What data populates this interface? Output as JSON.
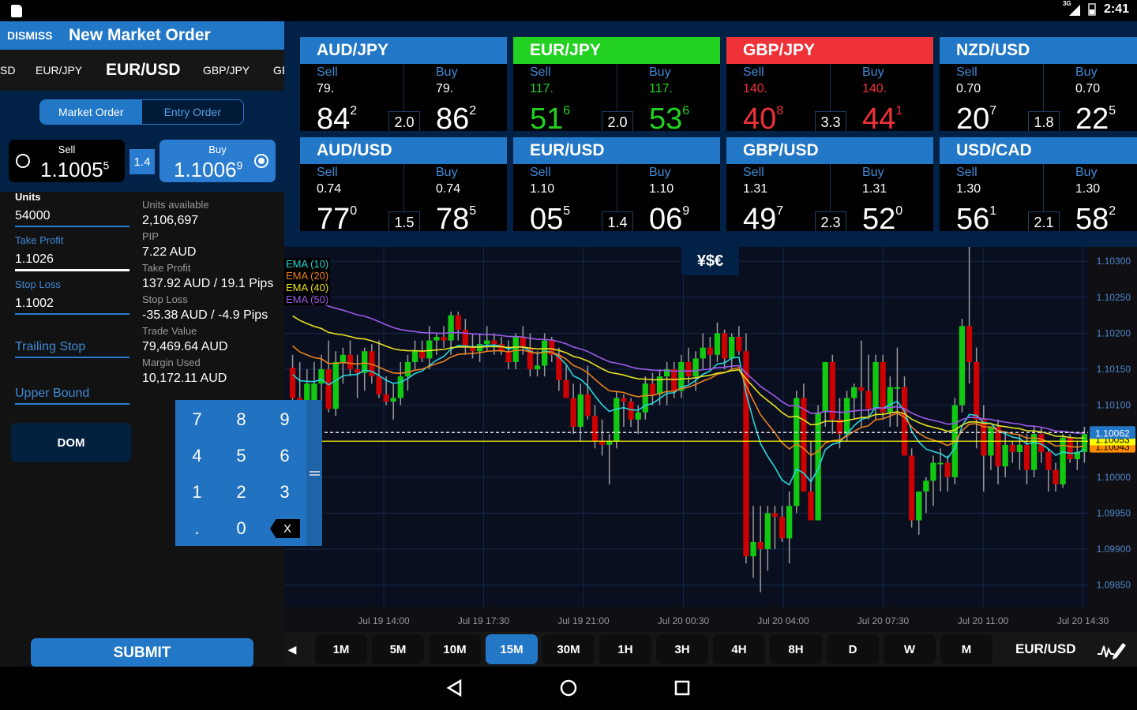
{
  "status_bar": {
    "network": "3G",
    "time": "2:41"
  },
  "order_panel": {
    "dismiss_label": "DISMISS",
    "title": "New Market Order",
    "pair_tabs": [
      "SD",
      "EUR/JPY",
      "EUR/USD",
      "GBP/JPY",
      "GE"
    ],
    "active_pair": "EUR/USD",
    "order_types": [
      {
        "label": "Market Order",
        "selected": true
      },
      {
        "label": "Entry Order",
        "selected": false
      }
    ],
    "sell": {
      "label": "Sell",
      "price_main": "1.1005",
      "price_sup": "5",
      "selected": false
    },
    "buy": {
      "label": "Buy",
      "price_main": "1.1006",
      "price_sup": "9",
      "selected": true
    },
    "spread": "1.4",
    "fields": {
      "units_label": "Units",
      "units_value": "54000",
      "take_profit_label": "Take Profit",
      "take_profit_value": "1.1026",
      "stop_loss_label": "Stop Loss",
      "stop_loss_value": "1.1002",
      "trailing_stop_label": "Trailing Stop",
      "upper_bound_label": "Upper Bound"
    },
    "info": [
      {
        "label": "Units available",
        "value": "2,106,697"
      },
      {
        "label": "PIP",
        "value": "7.22 AUD"
      },
      {
        "label": "Take Profit",
        "value": "137.92 AUD / 19.1 Pips"
      },
      {
        "label": "Stop Loss",
        "value": "-35.38 AUD / -4.9 Pips"
      },
      {
        "label": "Trade Value",
        "value": "79,469.64 AUD"
      },
      {
        "label": "Margin Used",
        "value": "10,172.11 AUD"
      }
    ],
    "dom_label": "DOM",
    "submit_label": "SUBMIT"
  },
  "keypad": {
    "keys": [
      "7",
      "8",
      "9",
      "4",
      "5",
      "6",
      "1",
      "2",
      "3",
      ".",
      "0"
    ],
    "delete_label": "X"
  },
  "quotes": [
    {
      "pair": "AUD/JPY",
      "header_color": "#2277c7",
      "price_color": "#ffffff",
      "sell_label": "Sell",
      "buy_label": "Buy",
      "sell_big": "79.",
      "sell_pips": "84",
      "sell_sup": "2",
      "buy_big": "79.",
      "buy_pips": "86",
      "buy_sup": "2",
      "spread": "2.0"
    },
    {
      "pair": "EUR/JPY",
      "header_color": "#22d122",
      "price_color": "#22d122",
      "sell_label": "Sell",
      "buy_label": "Buy",
      "sell_big": "117.",
      "sell_pips": "51",
      "sell_sup": "6",
      "buy_big": "117.",
      "buy_pips": "53",
      "buy_sup": "6",
      "spread": "2.0"
    },
    {
      "pair": "GBP/JPY",
      "header_color": "#ef3138",
      "price_color": "#ef3138",
      "sell_label": "Sell",
      "buy_label": "Buy",
      "sell_big": "140.",
      "sell_pips": "40",
      "sell_sup": "8",
      "buy_big": "140.",
      "buy_pips": "44",
      "buy_sup": "1",
      "spread": "3.3"
    },
    {
      "pair": "NZD/USD",
      "header_color": "#2277c7",
      "price_color": "#ffffff",
      "sell_label": "Sell",
      "buy_label": "Buy",
      "sell_big": "0.70",
      "sell_pips": "20",
      "sell_sup": "7",
      "buy_big": "0.70",
      "buy_pips": "22",
      "buy_sup": "5",
      "spread": "1.8"
    },
    {
      "pair": "AUD/USD",
      "header_color": "#2277c7",
      "price_color": "#ffffff",
      "sell_label": "Sell",
      "buy_label": "Buy",
      "sell_big": "0.74",
      "sell_pips": "77",
      "sell_sup": "0",
      "buy_big": "0.74",
      "buy_pips": "78",
      "buy_sup": "5",
      "spread": "1.5"
    },
    {
      "pair": "EUR/USD",
      "header_color": "#2277c7",
      "price_color": "#ffffff",
      "sell_label": "Sell",
      "buy_label": "Buy",
      "sell_big": "1.10",
      "sell_pips": "05",
      "sell_sup": "5",
      "buy_big": "1.10",
      "buy_pips": "06",
      "buy_sup": "9",
      "spread": "1.4"
    },
    {
      "pair": "GBP/USD",
      "header_color": "#2277c7",
      "price_color": "#ffffff",
      "sell_label": "Sell",
      "buy_label": "Buy",
      "sell_big": "1.31",
      "sell_pips": "49",
      "sell_sup": "7",
      "buy_big": "1.31",
      "buy_pips": "52",
      "buy_sup": "0",
      "spread": "2.3"
    },
    {
      "pair": "USD/CAD",
      "header_color": "#2277c7",
      "price_color": "#ffffff",
      "sell_label": "Sell",
      "buy_label": "Buy",
      "sell_big": "1.30",
      "sell_pips": "56",
      "sell_sup": "1",
      "buy_big": "1.30",
      "buy_pips": "58",
      "buy_sup": "2",
      "spread": "2.1"
    }
  ],
  "chart": {
    "symbol_icon": "¥$€",
    "legend": [
      {
        "label": "EMA (10)",
        "color": "#27d6dc"
      },
      {
        "label": "EMA (20)",
        "color": "#e8821e"
      },
      {
        "label": "EMA (40)",
        "color": "#e8e020"
      },
      {
        "label": "EMA (50)",
        "color": "#9a5ae6"
      }
    ],
    "colors": {
      "up": "#12c912",
      "down": "#cc0000",
      "wick": "#9a9a9a",
      "grid": "#10284a",
      "axis_text": "#4d86c4"
    }
  },
  "chart_data": {
    "type": "candlestick",
    "title": "EUR/USD 15M",
    "y_ticks": [
      "1.10300",
      "1.10250",
      "1.10200",
      "1.10150",
      "1.10100",
      "1.10000",
      "1.09950",
      "1.09900",
      "1.09850"
    ],
    "ylim": [
      1.0982,
      1.1032
    ],
    "x_ticks": [
      "Jul 19 14:00",
      "Jul 19 17:30",
      "Jul 19 21:00",
      "Jul 20 00:30",
      "Jul 20 04:00",
      "Jul 20 07:30",
      "Jul 20 11:00",
      "Jul 20 14:30"
    ],
    "price_tags": [
      {
        "label": "1.10062",
        "value": 1.10062,
        "color": "#2277c7"
      },
      {
        "label": "1.10053",
        "value": 1.10053,
        "color": "#ffff00"
      },
      {
        "label": "1.10043",
        "value": 1.10043,
        "color": "#ff8c00"
      }
    ],
    "current_price_line": 1.10062,
    "horizontal_line": 1.1005,
    "candles": [
      [
        1.10152,
        1.1017,
        1.101,
        1.1011
      ],
      [
        1.1011,
        1.1016,
        1.1008,
        1.10095
      ],
      [
        1.10095,
        1.1015,
        1.1006,
        1.1013
      ],
      [
        1.1009,
        1.1016,
        1.1007,
        1.1013
      ],
      [
        1.1013,
        1.1017,
        1.1009,
        1.1015
      ],
      [
        1.1015,
        1.1019,
        1.1009,
        1.10095
      ],
      [
        1.10095,
        1.10175,
        1.10085,
        1.1016
      ],
      [
        1.1016,
        1.1018,
        1.1013,
        1.1017
      ],
      [
        1.1017,
        1.1019,
        1.1014,
        1.1015
      ],
      [
        1.1015,
        1.1017,
        1.1011,
        1.10145
      ],
      [
        1.10145,
        1.1018,
        1.1012,
        1.10175
      ],
      [
        1.10175,
        1.10185,
        1.1013,
        1.1014
      ],
      [
        1.1014,
        1.1019,
        1.1011,
        1.10115
      ],
      [
        1.10115,
        1.1014,
        1.101,
        1.10105
      ],
      [
        1.10105,
        1.1013,
        1.1008,
        1.1011
      ],
      [
        1.1011,
        1.1016,
        1.101,
        1.1014
      ],
      [
        1.1014,
        1.1017,
        1.1012,
        1.1016
      ],
      [
        1.1016,
        1.1019,
        1.1015,
        1.10175
      ],
      [
        1.10175,
        1.1019,
        1.1016,
        1.10165
      ],
      [
        1.10165,
        1.1021,
        1.1015,
        1.1019
      ],
      [
        1.1019,
        1.102,
        1.1017,
        1.10195
      ],
      [
        1.10195,
        1.1021,
        1.1018,
        1.1019
      ],
      [
        1.1019,
        1.1023,
        1.1017,
        1.10225
      ],
      [
        1.10225,
        1.1023,
        1.1019,
        1.10205
      ],
      [
        1.10205,
        1.1022,
        1.1017,
        1.1018
      ],
      [
        1.1018,
        1.102,
        1.10165,
        1.10175
      ],
      [
        1.10175,
        1.102,
        1.1016,
        1.10185
      ],
      [
        1.10185,
        1.1021,
        1.10175,
        1.1019
      ],
      [
        1.1019,
        1.102,
        1.1017,
        1.10185
      ],
      [
        1.10185,
        1.10195,
        1.1017,
        1.10175
      ],
      [
        1.10175,
        1.1019,
        1.1015,
        1.1016
      ],
      [
        1.1016,
        1.102,
        1.1015,
        1.10195
      ],
      [
        1.10195,
        1.1021,
        1.1017,
        1.1018
      ],
      [
        1.1018,
        1.102,
        1.1014,
        1.1015
      ],
      [
        1.1015,
        1.10175,
        1.1014,
        1.10155
      ],
      [
        1.10155,
        1.102,
        1.1014,
        1.1019
      ],
      [
        1.1019,
        1.10195,
        1.1016,
        1.1017
      ],
      [
        1.1017,
        1.1018,
        1.1012,
        1.10135
      ],
      [
        1.10135,
        1.10155,
        1.1011,
        1.1011
      ],
      [
        1.1011,
        1.1013,
        1.1006,
        1.1007
      ],
      [
        1.1007,
        1.1013,
        1.1005,
        1.10115
      ],
      [
        1.10115,
        1.10155,
        1.1008,
        1.10085
      ],
      [
        1.10085,
        1.101,
        1.1004,
        1.1005
      ],
      [
        1.1005,
        1.1008,
        1.1003,
        1.10045
      ],
      [
        1.10045,
        1.1006,
        1.0999,
        1.1005
      ],
      [
        1.1005,
        1.1012,
        1.1004,
        1.1011
      ],
      [
        1.1011,
        1.10115,
        1.1007,
        1.10105
      ],
      [
        1.10105,
        1.1011,
        1.1007,
        1.1008
      ],
      [
        1.1008,
        1.101,
        1.1006,
        1.1009
      ],
      [
        1.1009,
        1.1014,
        1.1008,
        1.1013
      ],
      [
        1.1013,
        1.10145,
        1.101,
        1.10115
      ],
      [
        1.10115,
        1.1015,
        1.101,
        1.1014
      ],
      [
        1.1014,
        1.1016,
        1.101,
        1.1015
      ],
      [
        1.1015,
        1.1016,
        1.1011,
        1.1012
      ],
      [
        1.1012,
        1.1017,
        1.1011,
        1.1016
      ],
      [
        1.1016,
        1.1018,
        1.1013,
        1.1014
      ],
      [
        1.1014,
        1.10175,
        1.1012,
        1.10165
      ],
      [
        1.10165,
        1.102,
        1.1015,
        1.1018
      ],
      [
        1.1018,
        1.10195,
        1.1015,
        1.1017
      ],
      [
        1.1017,
        1.10215,
        1.1016,
        1.102
      ],
      [
        1.102,
        1.10205,
        1.1015,
        1.10165
      ],
      [
        1.10165,
        1.102,
        1.1015,
        1.10195
      ],
      [
        1.10195,
        1.1021,
        1.1017,
        1.10175
      ],
      [
        1.10175,
        1.102,
        1.0988,
        1.0989
      ],
      [
        1.0989,
        1.0996,
        1.0986,
        1.0991
      ],
      [
        1.0991,
        1.0996,
        1.0984,
        1.099
      ],
      [
        1.099,
        1.0996,
        1.0987,
        1.0995
      ],
      [
        1.0995,
        1.0996,
        1.099,
        1.09945
      ],
      [
        1.09945,
        1.0996,
        1.0991,
        1.09915
      ],
      [
        1.09915,
        1.0998,
        1.0988,
        1.0996
      ],
      [
        1.0996,
        1.1012,
        1.0995,
        1.1011
      ],
      [
        1.1011,
        1.1013,
        1.0998,
        1.0998
      ],
      [
        1.0998,
        1.1005,
        1.0995,
        1.0994
      ],
      [
        1.0994,
        1.101,
        1.0994,
        1.1009
      ],
      [
        1.1009,
        1.1016,
        1.1007,
        1.1016
      ],
      [
        1.1016,
        1.1017,
        1.1006,
        1.1008
      ],
      [
        1.1008,
        1.1011,
        1.1004,
        1.1006
      ],
      [
        1.1006,
        1.1012,
        1.1005,
        1.1011
      ],
      [
        1.1011,
        1.1013,
        1.1008,
        1.10125
      ],
      [
        1.10125,
        1.1019,
        1.1007,
        1.1012
      ],
      [
        1.1012,
        1.1017,
        1.1008,
        1.10095
      ],
      [
        1.10095,
        1.1017,
        1.1008,
        1.1016
      ],
      [
        1.1016,
        1.1017,
        1.1008,
        1.1009
      ],
      [
        1.1009,
        1.1014,
        1.1007,
        1.10125
      ],
      [
        1.10125,
        1.1018,
        1.1007,
        1.10125
      ],
      [
        1.10125,
        1.1014,
        1.1004,
        1.1003
      ],
      [
        1.1003,
        1.1004,
        1.0993,
        1.0994
      ],
      [
        1.0994,
        1.0998,
        1.0992,
        1.0998
      ],
      [
        1.0998,
        1.1,
        1.0995,
        1.09995
      ],
      [
        1.09995,
        1.1003,
        1.0996,
        1.1002
      ],
      [
        1.1002,
        1.1004,
        1.0998,
        1.1002
      ],
      [
        1.1002,
        1.1003,
        1.0998,
        1.1
      ],
      [
        1.1,
        1.1011,
        1.0999,
        1.101
      ],
      [
        1.101,
        1.1022,
        1.1009,
        1.1021
      ],
      [
        1.1021,
        1.1032,
        1.1013,
        1.1016
      ],
      [
        1.1016,
        1.1018,
        1.1004,
        1.1008
      ],
      [
        1.1008,
        1.101,
        1.0998,
        1.1003
      ],
      [
        1.1003,
        1.1007,
        1.1001,
        1.1007
      ],
      [
        1.1007,
        1.1008,
        1.0999,
        1.10015
      ],
      [
        1.10015,
        1.1006,
        1.1,
        1.10045
      ],
      [
        1.10045,
        1.1005,
        1.1002,
        1.10035
      ],
      [
        1.10035,
        1.1006,
        1.1001,
        1.10045
      ],
      [
        1.10045,
        1.1006,
        1.0999,
        1.1001
      ],
      [
        1.1001,
        1.1007,
        1.1,
        1.1006
      ],
      [
        1.1006,
        1.1007,
        1.1002,
        1.10035
      ],
      [
        1.10035,
        1.1004,
        1.0998,
        1.1001
      ],
      [
        1.1001,
        1.1002,
        1.0998,
        1.0999
      ],
      [
        1.0999,
        1.1006,
        1.09985,
        1.10055
      ],
      [
        1.10055,
        1.1006,
        1.1002,
        1.10025
      ],
      [
        1.10025,
        1.1005,
        1.1001,
        1.10035
      ],
      [
        1.10035,
        1.1007,
        1.1002,
        1.1006
      ]
    ]
  },
  "timeframes": {
    "items": [
      "1M",
      "5M",
      "10M",
      "15M",
      "30M",
      "1H",
      "3H",
      "4H",
      "8H",
      "D",
      "W",
      "M"
    ],
    "selected": "15M",
    "symbol": "EUR/USD"
  }
}
